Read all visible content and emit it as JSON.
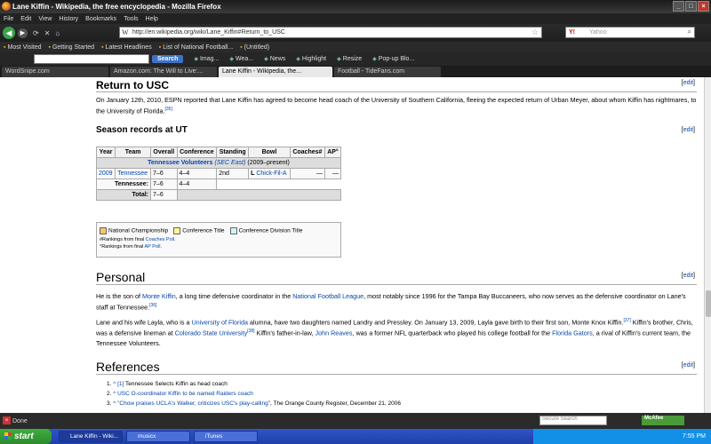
{
  "window": {
    "title": "Lane Kiffin - Wikipedia, the free encyclopedia - Mozilla Firefox"
  },
  "menu": [
    "File",
    "Edit",
    "View",
    "History",
    "Bookmarks",
    "Tools",
    "Help"
  ],
  "nav": {
    "url": "http://en.wikipedia.org/wiki/Lane_Kiffin#Return_to_USC",
    "search_placeholder": "Yahoo"
  },
  "bookmarks": [
    "Most Visited",
    "Getting Started",
    "Latest Headlines",
    "List of National Football...",
    "(Untitled)"
  ],
  "toolbar": {
    "search_label": "Search",
    "items": [
      "Imag...",
      "Wea...",
      "News",
      "Highlight",
      "Resize",
      "Pop-up Blo..."
    ]
  },
  "tabs": [
    {
      "label": "WordSnipe.com"
    },
    {
      "label": "Amazon.com: The Will to Live:..."
    },
    {
      "label": "Lane Kiffin - Wikipedia, the..."
    },
    {
      "label": "Football - TideFans.com"
    }
  ],
  "content": {
    "edit_label": "edit",
    "return_heading": "Return to USC",
    "return_text_1": "On January 12th, 2010, ESPN reported that Lane Kiffin has agreed to become head coach of the University of Southern California, fleeing the expected return of Urban Meyer, about whom Kiffin",
    "return_text_2": "has nightmares, to the University of Florida.",
    "return_ref": "[35]",
    "season_heading": "Season records at UT",
    "table": {
      "headers": [
        "Year",
        "Team",
        "Overall",
        "Conference",
        "Standing",
        "Bowl",
        "Coaches#",
        "AP°"
      ],
      "span_link": "Tennessee Volunteers",
      "span_conf": "(SEC East)",
      "span_years": "(2009–present)",
      "row": {
        "year": "2009",
        "team": "Tennessee",
        "overall": "7–6",
        "conference": "4–4",
        "standing": "2nd",
        "bowl_result": "L",
        "bowl": "Chick-Fil-A",
        "coaches": "—",
        "ap": "—"
      },
      "subtotal_label": "Tennessee:",
      "subtotal_overall": "7–6",
      "subtotal_conf": "4–4",
      "total_label": "Total:",
      "total_overall": "7–6"
    },
    "legend": {
      "items": [
        "National Championship",
        "Conference Title",
        "Conference Division Title"
      ],
      "colors": [
        "#f6c769",
        "#fff59a",
        "#cdf6f6"
      ],
      "coaches_note": "#Rankings from final",
      "coaches_link": "Coaches Poll.",
      "ap_note": "°Rankings from final",
      "ap_link": "AP Poll."
    },
    "personal_heading": "Personal",
    "personal_p1_a": "He is the son of",
    "personal_p1_link1": "Monte Kiffin",
    "personal_p1_b": ", a long time defensive coordinator in the",
    "personal_p1_link2": "National Football League",
    "personal_p1_c": ", most notably since 1996 for the Tampa Bay Buccaneers, who now serves as the defensive",
    "personal_p1_d": "coordinator on Lane's staff at Tennessee.",
    "personal_p1_ref": "[36]",
    "personal_p2_a": "Lane and his wife Layla, who is a",
    "personal_p2_link1": "University of Florida",
    "personal_p2_b": "alumna, have two daughters named Landry and Pressley. On January 13, 2009, Layla gave birth to their first son, Monte Knox Kiffin.",
    "personal_p2_ref1": "[37]",
    "personal_p2_c": "Kiffin's brother, Chris, was a defensive lineman at",
    "personal_p2_link2": "Colorado State University",
    "personal_p2_ref2": "[38]",
    "personal_p2_d": "Kiffin's father-in-law,",
    "personal_p2_link3": "John Reaves",
    "personal_p2_e": ", was a former NFL quarterback who played his college football for the",
    "personal_p2_link4": "Florida",
    "personal_p2_link5": "Gators",
    "personal_p2_f": ", a rival of Kiffin's current team, the Tennessee Volunteers.",
    "references_heading": "References",
    "refs": [
      {
        "num": "1.",
        "caret": "^",
        "link": "[1]",
        "text": "Tennessee Selects Kiffin as head coach"
      },
      {
        "num": "2.",
        "caret": "^",
        "link": "USC O-coordinator Kiffin to be named Raiders coach",
        "text": ""
      },
      {
        "num": "3.",
        "caret": "^",
        "link": "\"Chow praises UCLA's Walker, criticizes USC's play-calling\"",
        "text": ", The Orange County Register, December 21, 2006"
      }
    ]
  },
  "status": {
    "text": "Done",
    "secure_search": "Secure Search",
    "mcafee": "McAfee"
  },
  "taskbar": {
    "start": "start",
    "tasks": [
      "Lane Kiffin - Wiki...",
      "musicx",
      "iTunes"
    ],
    "clock": "7:55 PM"
  }
}
